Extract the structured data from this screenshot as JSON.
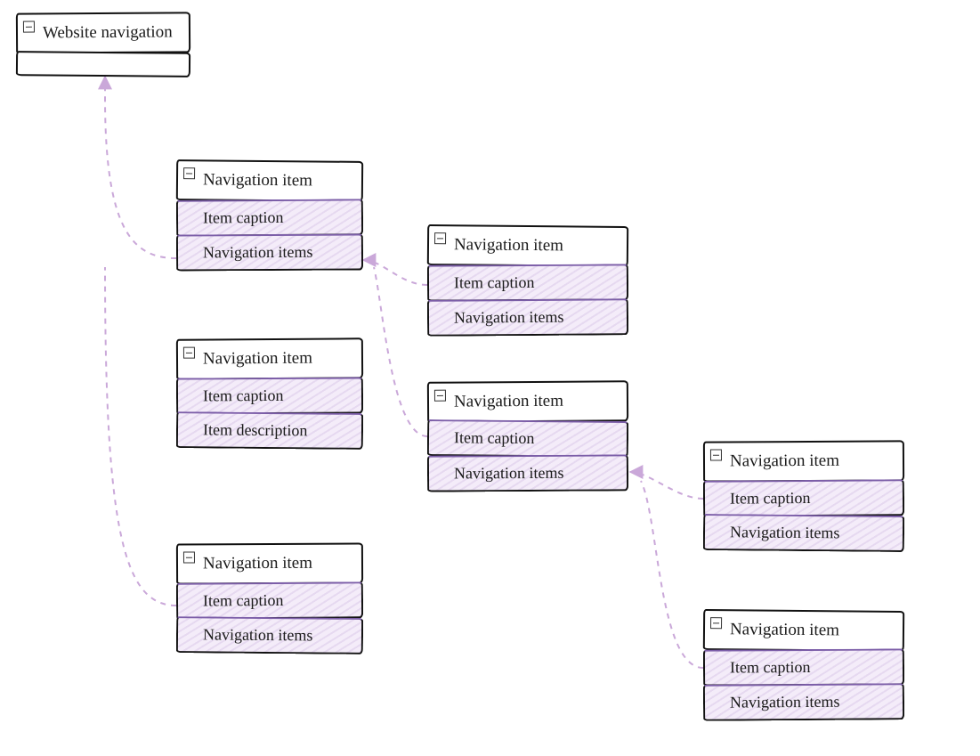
{
  "nodes": {
    "root": {
      "header": "Website navigation",
      "rows": []
    },
    "n1": {
      "header": "Navigation item",
      "rows": [
        "Item caption",
        "Navigation items"
      ]
    },
    "n2": {
      "header": "Navigation item",
      "rows": [
        "Item caption",
        "Item description"
      ]
    },
    "n3": {
      "header": "Navigation item",
      "rows": [
        "Item caption",
        "Navigation items"
      ]
    },
    "n1a": {
      "header": "Navigation item",
      "rows": [
        "Item caption",
        "Navigation items"
      ]
    },
    "n1b": {
      "header": "Navigation item",
      "rows": [
        "Item caption",
        "Navigation items"
      ]
    },
    "n1b1": {
      "header": "Navigation item",
      "rows": [
        "Item caption",
        "Navigation items"
      ]
    },
    "n1b2": {
      "header": "Navigation item",
      "rows": [
        "Item caption",
        "Navigation items"
      ]
    }
  },
  "colors": {
    "connector": "#caa8d9",
    "attr_border": "#7c5ea8"
  }
}
